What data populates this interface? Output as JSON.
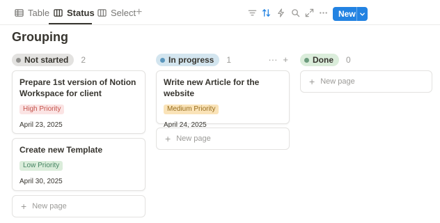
{
  "views": [
    {
      "label": "Table",
      "icon": "table-icon"
    },
    {
      "label": "Status",
      "icon": "board-icon"
    },
    {
      "label": "Select",
      "icon": "board-icon"
    }
  ],
  "toolbar": {
    "add_view": "+",
    "new_label": "New",
    "tools": [
      "filter-icon",
      "sort-icon",
      "automation-icon",
      "search-icon",
      "expand-icon",
      "more-icon"
    ]
  },
  "page_title": "Grouping",
  "columns": [
    {
      "status": "Not started",
      "count": "2",
      "pill_bg": "#e3e2e0",
      "dot_color": "#91918e",
      "cards": [
        {
          "title": "Prepare 1st version of Notion Workspace for client",
          "tag": "High Priority",
          "date": "April 23, 2025"
        },
        {
          "title": "Create new Template",
          "tag": "Low Priority",
          "date": "April 30, 2025"
        }
      ],
      "new_page": "New page"
    },
    {
      "status": "In progress",
      "count": "1",
      "pill_bg": "#d3e5ef",
      "dot_color": "#5b97bd",
      "actions": [
        "···",
        "+"
      ],
      "cards": [
        {
          "title": "Write new Article for the website",
          "tag": "Medium Priority",
          "date": "April 24, 2025"
        }
      ],
      "new_page": "New page"
    },
    {
      "status": "Done",
      "count": "0",
      "pill_bg": "#dbeddb",
      "dot_color": "#6c9b7d",
      "cards": [],
      "new_page": "New page"
    }
  ]
}
